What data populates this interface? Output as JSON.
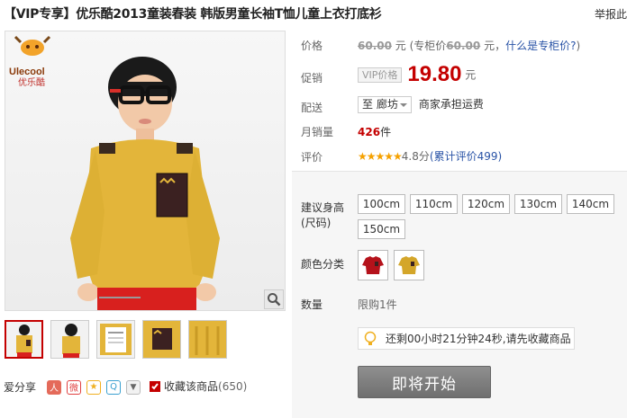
{
  "header": {
    "title": "【VIP专享】优乐酷2013童装春装 韩版男童长袖T恤儿童上衣打底衫",
    "report_link": "举报此"
  },
  "brand_logo_text": "优乐酷",
  "gallery": {
    "thumbnail_count": 5,
    "zoom_icon": "magnifier-icon"
  },
  "share": {
    "label": "爱分享",
    "icons": [
      "renren-icon",
      "weibo-icon",
      "qzone-icon",
      "tencent-weibo-icon",
      "more-icon"
    ]
  },
  "favorite": {
    "label": "收藏该商品",
    "count": "(650)"
  },
  "price_block": {
    "price_label": "价格",
    "price_value": "60.00",
    "price_unit": "元 (专柜价",
    "counter_price": "60.00",
    "counter_unit": "元，",
    "what_is_counter": "什么是专柜价?",
    "close_paren": ")",
    "promo_label": "促销",
    "vip_tag": "VIP价格",
    "promo_price": "19.80",
    "promo_unit": "元",
    "ship_label": "配送",
    "ship_to": "至 廊坊",
    "ship_note": "商家承担运费",
    "sales_label": "月销量",
    "sales_value": "426",
    "sales_unit": "件",
    "rating_label": "评价",
    "rating_stars": "★★★★★",
    "rating_score": "4.8分",
    "rating_count": "(累计评价499)"
  },
  "options": {
    "size_label_1": "建议身高",
    "size_label_2": "(尺码)",
    "sizes": [
      "100cm",
      "110cm",
      "120cm",
      "130cm",
      "140cm",
      "150cm"
    ],
    "color_label": "颜色分类",
    "colors": [
      {
        "name": "red-shirt-swatch",
        "hex": "#b5121b"
      },
      {
        "name": "yellow-shirt-swatch",
        "hex": "#d4a62a"
      }
    ],
    "qty_label": "数量",
    "qty_limit": "限购1件"
  },
  "tip": {
    "icon": "lightbulb-icon",
    "text": "还剩00小时21分钟24秒,请先收藏商品"
  },
  "cta": {
    "label": "即将开始"
  },
  "colors": {
    "accent_red": "#c40000",
    "link_blue": "#2953a6",
    "button_gray": "#7c7c7c"
  }
}
